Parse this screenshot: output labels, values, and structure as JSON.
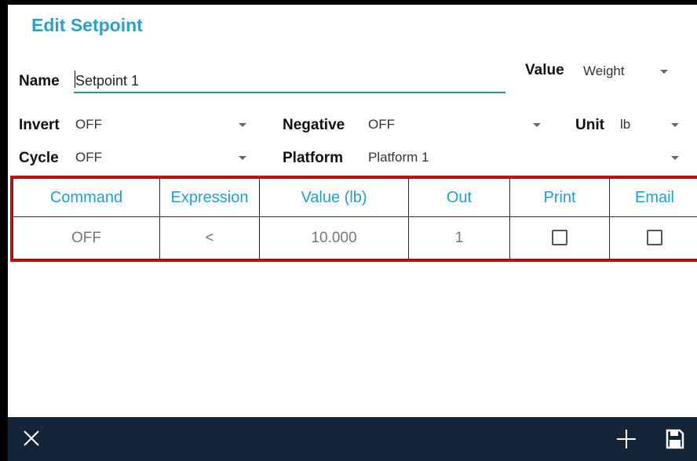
{
  "dialog": {
    "title": "Edit Setpoint"
  },
  "fields": {
    "name_label": "Name",
    "name_value": "Setpoint 1",
    "value_label": "Value",
    "value_value": "Weight",
    "invert_label": "Invert",
    "invert_value": "OFF",
    "negative_label": "Negative",
    "negative_value": "OFF",
    "unit_label": "Unit",
    "unit_value": "lb",
    "cycle_label": "Cycle",
    "cycle_value": "OFF",
    "platform_label": "Platform",
    "platform_value": "Platform 1"
  },
  "table": {
    "headers": [
      "Command",
      "Expression",
      "Value (lb)",
      "Out",
      "Print",
      "Email"
    ],
    "rows": [
      {
        "command": "OFF",
        "expression": "<",
        "value": "10.000",
        "out": "1",
        "print": false,
        "email": false
      }
    ]
  },
  "bottombar": {
    "close_icon": "close-icon",
    "add_icon": "plus-icon",
    "save_icon": "save-icon"
  },
  "colors": {
    "title": "#2a9fd0",
    "header_text": "#1e9fd6",
    "highlight": "#e00000",
    "bar": "#132537",
    "underline": "#1c9d96"
  }
}
